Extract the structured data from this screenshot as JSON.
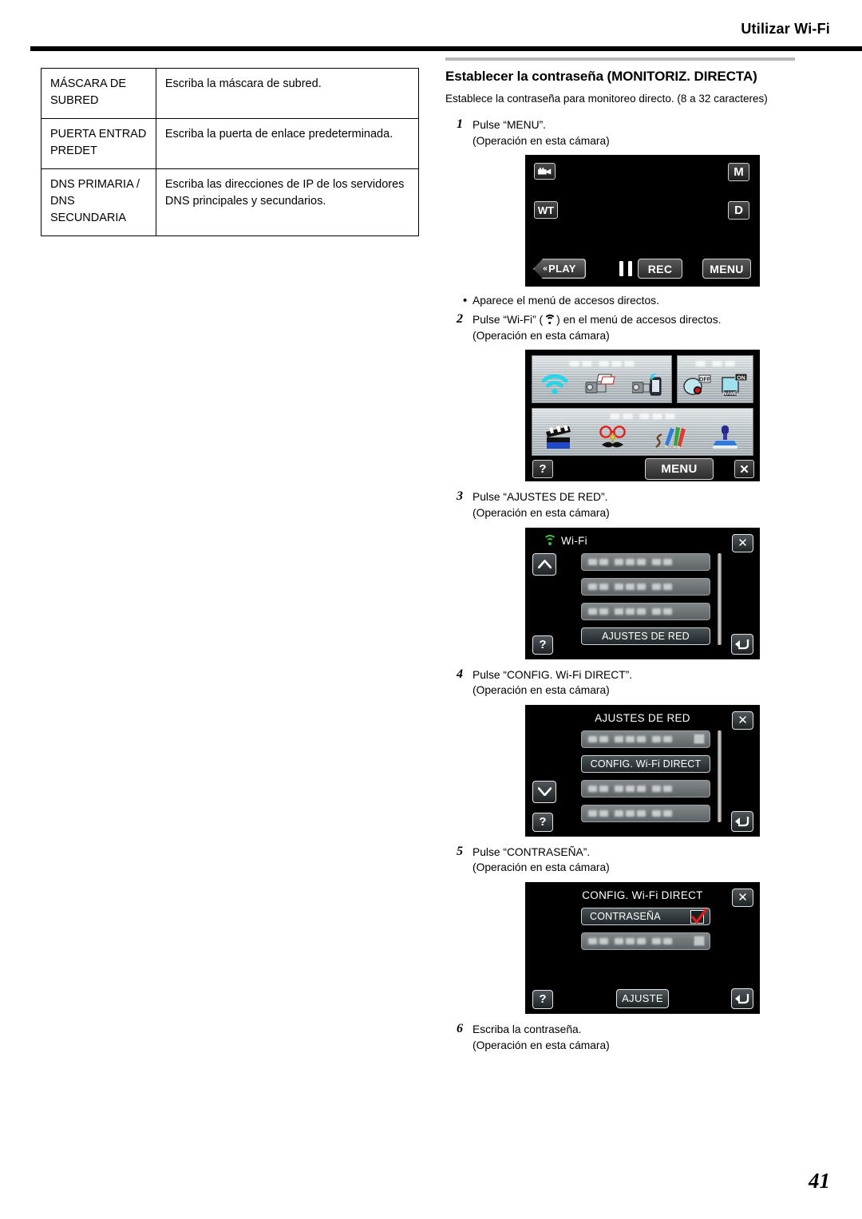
{
  "header": {
    "title": "Utilizar Wi-Fi",
    "page_number": "41"
  },
  "spec_table": {
    "rows": [
      {
        "key": "MÁSCARA DE SUBRED",
        "value": "Escriba la máscara de subred."
      },
      {
        "key": "PUERTA ENTRAD PREDET",
        "value": "Escriba la puerta de enlace predeterminada."
      },
      {
        "key": "DNS PRIMARIA / DNS SECUNDARIA",
        "value": "Escriba las direcciones de IP de los servidores DNS principales y secundarios."
      }
    ]
  },
  "section": {
    "title": "Establecer la contraseña (MONITORIZ. DIRECTA)",
    "description": "Establece la contraseña para monitoreo directo. (8 a 32 caracteres)"
  },
  "steps": {
    "one": {
      "num": "1",
      "text": "Pulse “MENU”.",
      "sub": "(Operación en esta cámara)"
    },
    "note_one": "Aparece el menú de accesos directos.",
    "two": {
      "num": "2",
      "text_before": "Pulse “Wi-Fi” (",
      "text_after": ") en el menú de accesos directos.",
      "sub": "(Operación en esta cámara)"
    },
    "three": {
      "num": "3",
      "text": "Pulse “AJUSTES DE RED”.",
      "sub": "(Operación en esta cámara)"
    },
    "four": {
      "num": "4",
      "text": "Pulse “CONFIG. Wi-Fi DIRECT”.",
      "sub": "(Operación en esta cámara)"
    },
    "five": {
      "num": "5",
      "text": "Pulse “CONTRASEÑA”.",
      "sub": "(Operación en esta cámara)"
    },
    "six": {
      "num": "6",
      "text": "Escriba la contraseña.",
      "sub": "(Operación en esta cámara)"
    }
  },
  "screen_rec": {
    "mode_label": "M",
    "zoom_label": "WT",
    "display_label": "D",
    "play_label": "PLAY",
    "rec_label": "REC",
    "menu_label": "MENU"
  },
  "screen_shortcut": {
    "help_label": "?",
    "menu_label": "MENU",
    "close_label": "✕",
    "icons": {
      "wifi": "wifi-icon",
      "camera_to_pc": "camera-to-pc-icon",
      "camera_to_phone": "camera-to-phone-icon",
      "face_detect": "face-detect-icon",
      "name_tag": "name-tag-icon",
      "clapper": "clapperboard-icon",
      "glasses": "glasses-mustache-icon",
      "pencils": "pencils-icon",
      "stamp": "stamp-icon"
    }
  },
  "screen_wifi": {
    "title": "Wi-Fi",
    "selected_item": "AJUSTES DE RED",
    "help_label": "?",
    "close_label": "✕"
  },
  "screen_network": {
    "title": "AJUSTES DE RED",
    "selected_item": "CONFIG. Wi-Fi DIRECT",
    "help_label": "?",
    "close_label": "✕"
  },
  "screen_direct": {
    "title": "CONFIG. Wi-Fi DIRECT",
    "selected_item": "CONTRASEÑA",
    "set_label": "AJUSTE",
    "help_label": "?",
    "close_label": "✕"
  },
  "colors": {
    "wifi_cyan": "#27d5e8",
    "wifi_green": "#3fbf3f",
    "check_red": "#e21c1c",
    "rule_gray": "#b8b8b8"
  }
}
